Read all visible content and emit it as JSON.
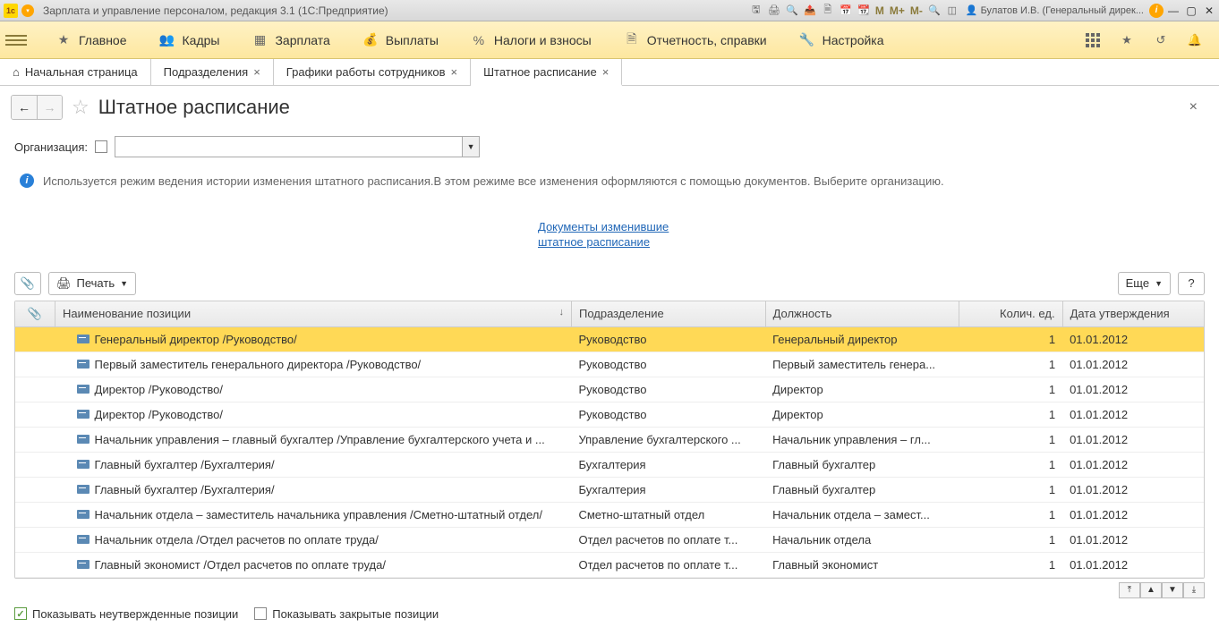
{
  "titlebar": {
    "title": "Зарплата и управление персоналом, редакция 3.1  (1С:Предприятие)",
    "user": "Булатов И.В. (Генеральный дирек...",
    "m_labels": [
      "M",
      "M+",
      "M-"
    ]
  },
  "mainmenu": {
    "items": [
      {
        "label": "Главное",
        "icon": "star"
      },
      {
        "label": "Кадры",
        "icon": "people"
      },
      {
        "label": "Зарплата",
        "icon": "calc"
      },
      {
        "label": "Выплаты",
        "icon": "money"
      },
      {
        "label": "Налоги и взносы",
        "icon": "percent"
      },
      {
        "label": "Отчетность, справки",
        "icon": "doc"
      },
      {
        "label": "Настройка",
        "icon": "wrench"
      }
    ]
  },
  "tabs": [
    {
      "label": "Начальная страница",
      "closable": false,
      "home": true
    },
    {
      "label": "Подразделения",
      "closable": true
    },
    {
      "label": "Графики работы сотрудников",
      "closable": true
    },
    {
      "label": "Штатное расписание",
      "closable": true,
      "active": true
    }
  ],
  "page": {
    "title": "Штатное расписание",
    "filter_label": "Организация:",
    "info_text": "Используется режим ведения истории изменения штатного расписания.В этом режиме все изменения оформляются с помощью документов. Выберите организацию.",
    "doc_link": "Документы изменившие штатное расписание",
    "print_label": "Печать",
    "more_label": "Еще",
    "help_label": "?",
    "show_unapproved": "Показывать неутвержденные позиции",
    "show_closed": "Показывать закрытые позиции"
  },
  "table": {
    "columns": {
      "name": "Наименование позиции",
      "dept": "Подразделение",
      "pos": "Должность",
      "qty": "Колич. ед.",
      "date": "Дата утверждения"
    },
    "rows": [
      {
        "name": "Генеральный директор /Руководство/",
        "dept": "Руководство",
        "pos": "Генеральный директор",
        "qty": "1",
        "date": "01.01.2012",
        "selected": true
      },
      {
        "name": "Первый заместитель генерального директора /Руководство/",
        "dept": "Руководство",
        "pos": "Первый заместитель генера...",
        "qty": "1",
        "date": "01.01.2012"
      },
      {
        "name": "Директор /Руководство/",
        "dept": "Руководство",
        "pos": "Директор",
        "qty": "1",
        "date": "01.01.2012"
      },
      {
        "name": "Директор /Руководство/",
        "dept": "Руководство",
        "pos": "Директор",
        "qty": "1",
        "date": "01.01.2012"
      },
      {
        "name": "Начальник управления – главный бухгалтер /Управление бухгалтерского учета и ...",
        "dept": "Управление бухгалтерского ...",
        "pos": "Начальник управления – гл...",
        "qty": "1",
        "date": "01.01.2012"
      },
      {
        "name": "Главный бухгалтер /Бухгалтерия/",
        "dept": "Бухгалтерия",
        "pos": "Главный бухгалтер",
        "qty": "1",
        "date": "01.01.2012"
      },
      {
        "name": "Главный бухгалтер /Бухгалтерия/",
        "dept": "Бухгалтерия",
        "pos": "Главный бухгалтер",
        "qty": "1",
        "date": "01.01.2012"
      },
      {
        "name": "Начальник отдела – заместитель начальника управления /Сметно-штатный отдел/",
        "dept": "Сметно-штатный отдел",
        "pos": "Начальник отдела – замест...",
        "qty": "1",
        "date": "01.01.2012"
      },
      {
        "name": "Начальник отдела /Отдел расчетов по оплате труда/",
        "dept": "Отдел расчетов по оплате т...",
        "pos": "Начальник отдела",
        "qty": "1",
        "date": "01.01.2012"
      },
      {
        "name": "Главный экономист /Отдел расчетов по оплате труда/",
        "dept": "Отдел расчетов по оплате т...",
        "pos": "Главный экономист",
        "qty": "1",
        "date": "01.01.2012"
      }
    ]
  }
}
